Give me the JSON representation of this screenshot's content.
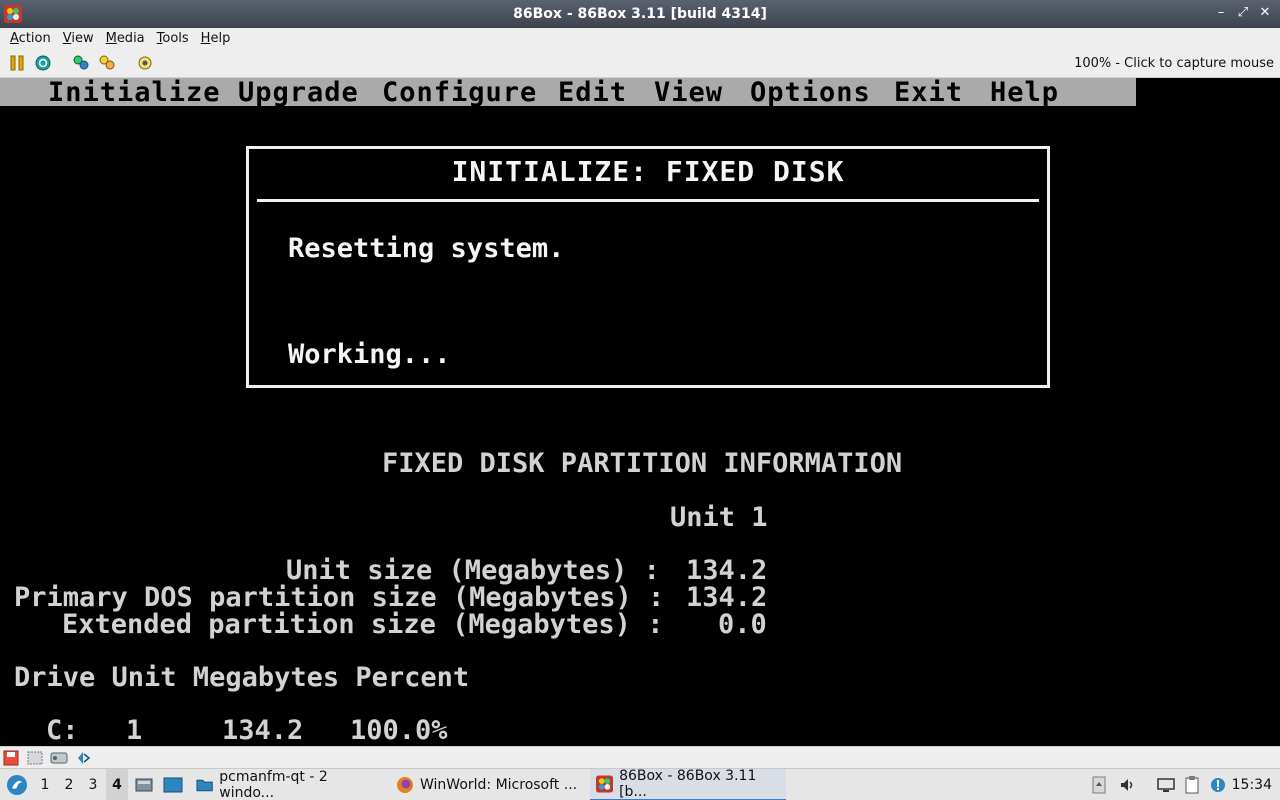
{
  "window": {
    "title": "86Box - 86Box 3.11 [build 4314]",
    "controls": [
      "–",
      "⤢",
      "✕"
    ]
  },
  "menubar": {
    "items": [
      {
        "label": "Action",
        "u": "A",
        "rest": "ction"
      },
      {
        "label": "View",
        "u": "V",
        "rest": "iew"
      },
      {
        "label": "Media",
        "u": "M",
        "rest": "edia"
      },
      {
        "label": "Tools",
        "u": "T",
        "rest": "ools"
      },
      {
        "label": "Help",
        "u": "H",
        "rest": "elp"
      }
    ]
  },
  "toolbar": {
    "capture_text": "100% - Click to capture mouse",
    "buttons": [
      "pause-icon",
      "reset-icon",
      "ctrl-alt-del-icon",
      "ctrl-alt-esc-icon",
      "settings-icon"
    ]
  },
  "dos": {
    "menu": [
      "Initialize",
      "Upgrade",
      "Configure",
      "Edit",
      "View",
      "Options",
      "Exit",
      "Help"
    ],
    "dialog": {
      "title": "INITIALIZE:  FIXED DISK",
      "line1": "Resetting system.",
      "line2": "Working..."
    },
    "partition": {
      "heading": "FIXED DISK PARTITION INFORMATION",
      "unit_label": "Unit 1",
      "rows": [
        {
          "label": "Unit size (Megabytes) :",
          "value": "134.2"
        },
        {
          "label": "Primary DOS partition size (Megabytes) :",
          "value": "134.2"
        },
        {
          "label": "Extended partition size (Megabytes) :",
          "value": "0.0"
        }
      ],
      "table_header": "Drive Unit Megabytes Percent",
      "table_row": {
        "drive": "C:",
        "unit": "1",
        "megabytes": "134.2",
        "percent": "100.0%"
      }
    }
  },
  "statusbar": {
    "icons": [
      "floppy-icon",
      "cdrom-icon",
      "hdd-icon",
      "network-icon"
    ]
  },
  "taskbar": {
    "desktops": [
      "1",
      "2",
      "3",
      "4"
    ],
    "active_desktop": "4",
    "tasks": [
      {
        "label": "pcmanfm-qt - 2 windo...",
        "icon": "folder-icon"
      },
      {
        "label": "WinWorld: Microsoft ...",
        "icon": "firefox-icon"
      },
      {
        "label": "86Box - 86Box 3.11 [b...",
        "icon": "86box-icon"
      }
    ],
    "clock": "15:34"
  },
  "colors": {
    "dos_menu_bg": "#aaaaaa",
    "dos_text": "#d2d2d2",
    "dialog_text": "#f5f5f5",
    "chrome_bg": "#eeeeee"
  }
}
